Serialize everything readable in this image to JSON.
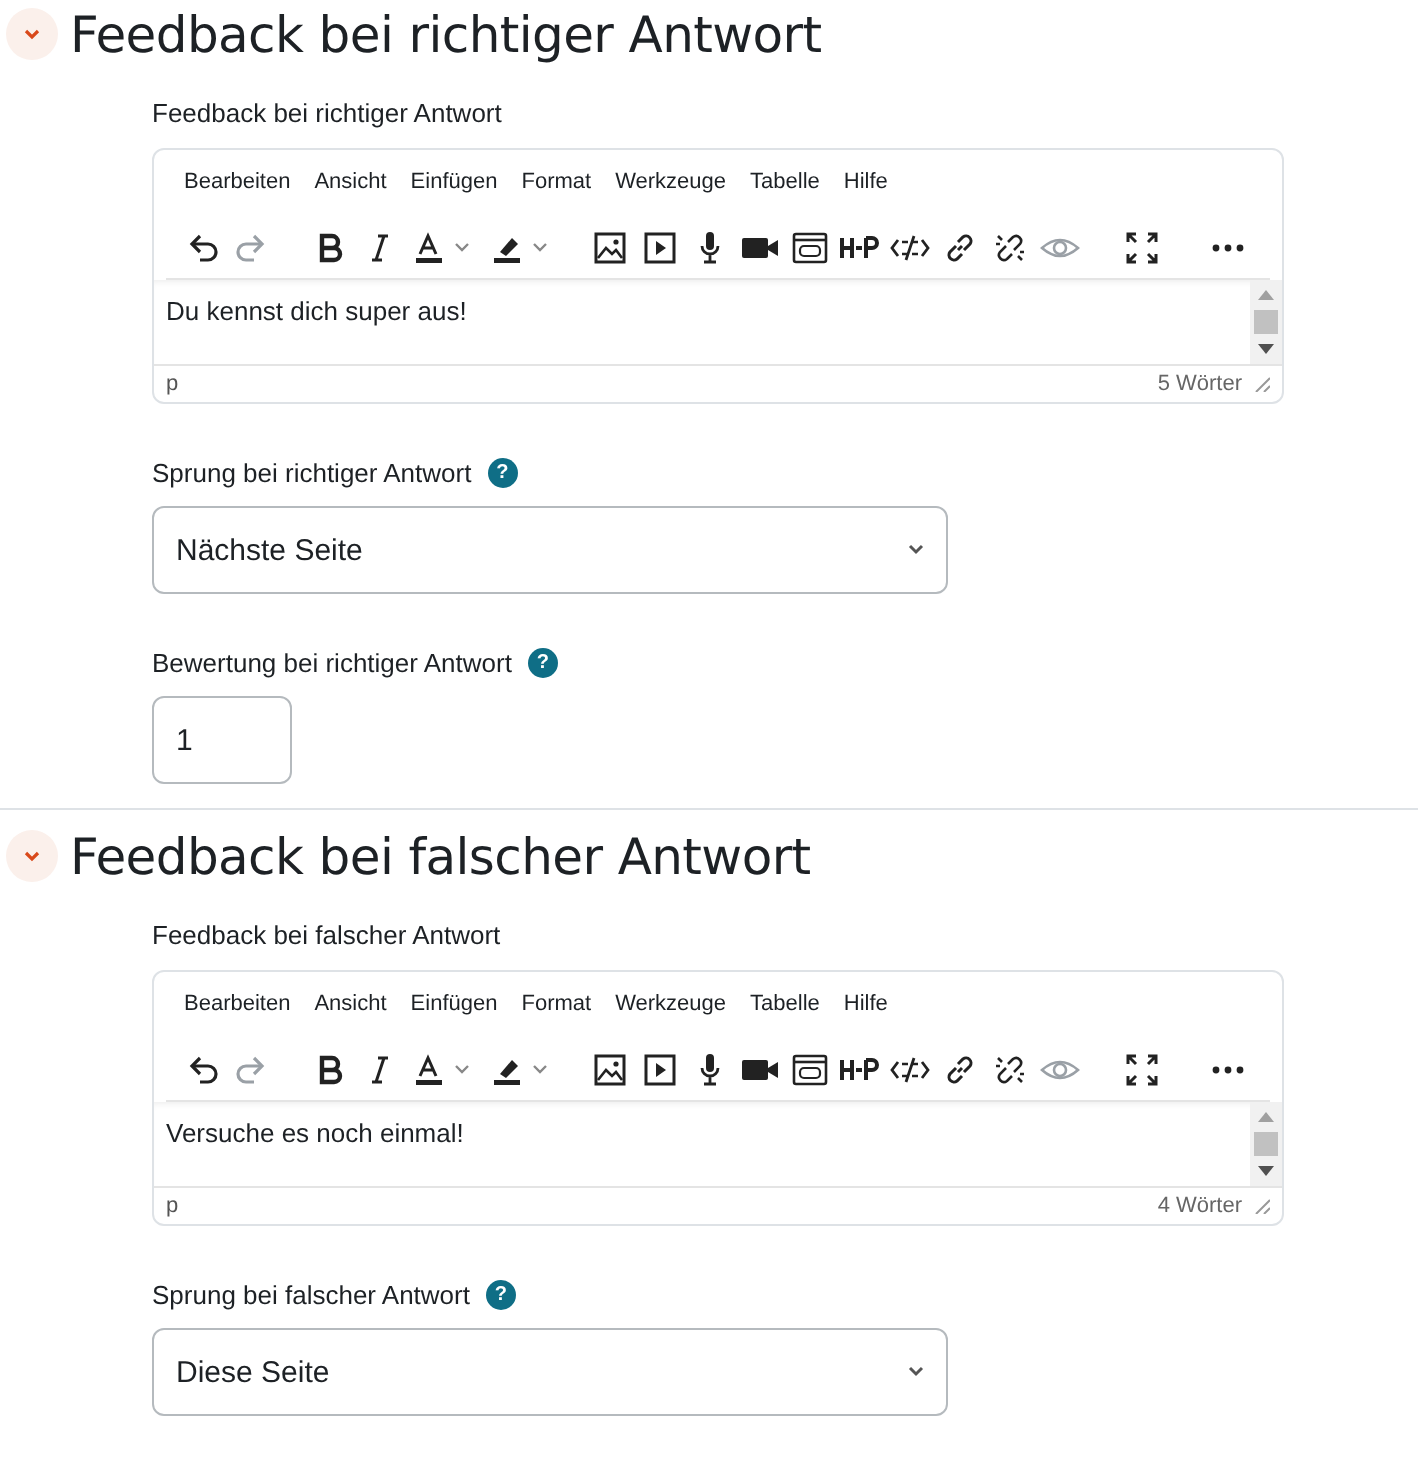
{
  "sections": [
    {
      "title": "Feedback bei richtiger Antwort",
      "expanded": true,
      "editor": {
        "label": "Feedback bei richtiger Antwort",
        "menu": [
          "Bearbeiten",
          "Ansicht",
          "Einfügen",
          "Format",
          "Werkzeuge",
          "Tabelle",
          "Hilfe"
        ],
        "toolbar": [
          {
            "kind": "undo",
            "disabled": false
          },
          {
            "kind": "redo",
            "disabled": true
          },
          {
            "kind": "bold",
            "disabled": false
          },
          {
            "kind": "italic",
            "disabled": false
          },
          {
            "kind": "textcolor",
            "disabled": false
          },
          {
            "kind": "highlight",
            "disabled": false
          },
          {
            "kind": "image",
            "disabled": false
          },
          {
            "kind": "media",
            "disabled": false
          },
          {
            "kind": "mic",
            "disabled": false
          },
          {
            "kind": "camera",
            "disabled": false
          },
          {
            "kind": "embed",
            "disabled": false
          },
          {
            "kind": "h5p",
            "disabled": false
          },
          {
            "kind": "html",
            "disabled": false
          },
          {
            "kind": "link",
            "disabled": false
          },
          {
            "kind": "unlink",
            "disabled": false
          },
          {
            "kind": "preview",
            "disabled": true
          },
          {
            "kind": "fullscreen",
            "disabled": false
          },
          {
            "kind": "more",
            "disabled": false
          }
        ],
        "content": "Du kennst dich super aus!",
        "path": "p",
        "word_count": "5 Wörter"
      },
      "jump": {
        "label": "Sprung bei richtiger Antwort",
        "help": "?",
        "value": "Nächste Seite"
      },
      "grade": {
        "label": "Bewertung bei richtiger Antwort",
        "help": "?",
        "value": "1"
      }
    },
    {
      "title": "Feedback bei falscher Antwort",
      "expanded": true,
      "editor": {
        "label": "Feedback bei falscher Antwort",
        "menu": [
          "Bearbeiten",
          "Ansicht",
          "Einfügen",
          "Format",
          "Werkzeuge",
          "Tabelle",
          "Hilfe"
        ],
        "toolbar": [
          {
            "kind": "undo",
            "disabled": false
          },
          {
            "kind": "redo",
            "disabled": true
          },
          {
            "kind": "bold",
            "disabled": false
          },
          {
            "kind": "italic",
            "disabled": false
          },
          {
            "kind": "textcolor",
            "disabled": false
          },
          {
            "kind": "highlight",
            "disabled": false
          },
          {
            "kind": "image",
            "disabled": false
          },
          {
            "kind": "media",
            "disabled": false
          },
          {
            "kind": "mic",
            "disabled": false
          },
          {
            "kind": "camera",
            "disabled": false
          },
          {
            "kind": "embed",
            "disabled": false
          },
          {
            "kind": "h5p",
            "disabled": false
          },
          {
            "kind": "html",
            "disabled": false
          },
          {
            "kind": "link",
            "disabled": false
          },
          {
            "kind": "unlink",
            "disabled": false
          },
          {
            "kind": "preview",
            "disabled": true
          },
          {
            "kind": "fullscreen",
            "disabled": false
          },
          {
            "kind": "more",
            "disabled": false
          }
        ],
        "content": "Versuche es noch einmal!",
        "path": "p",
        "word_count": "4 Wörter"
      },
      "jump": {
        "label": "Sprung bei falscher Antwort",
        "help": "?",
        "value": "Diese Seite"
      }
    }
  ]
}
